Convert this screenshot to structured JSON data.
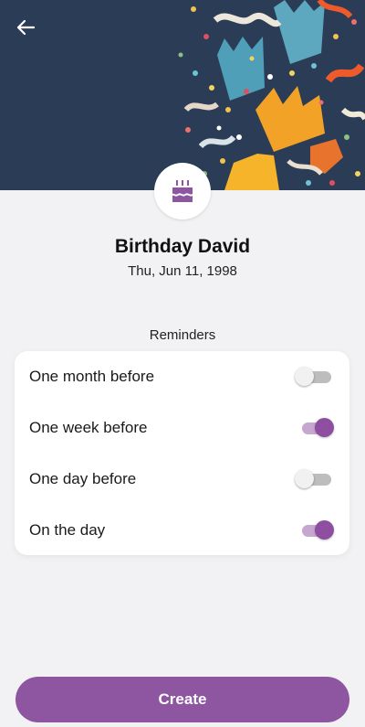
{
  "event": {
    "title": "Birthday David",
    "date": "Thu, Jun 11, 1998"
  },
  "header": {
    "back_icon": "arrow-left-icon",
    "image": "party-hats-confetti-photo",
    "avatar_icon": "birthday-cake-icon"
  },
  "reminders": {
    "label": "Reminders",
    "items": [
      {
        "label": "One month before",
        "enabled": false
      },
      {
        "label": "One week before",
        "enabled": true
      },
      {
        "label": "One day before",
        "enabled": false
      },
      {
        "label": "On the day",
        "enabled": true
      }
    ]
  },
  "actions": {
    "create_label": "Create"
  },
  "colors": {
    "accent": "#8e55a1",
    "toggle_on_knob": "#8e4fa0",
    "toggle_on_track": "#c7a6cf",
    "background": "#f2f2f5"
  }
}
